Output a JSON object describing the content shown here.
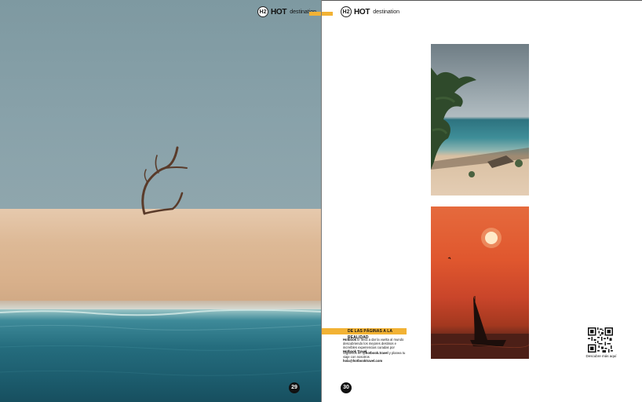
{
  "magazine": {
    "badge": "H2",
    "brand_hot": "HOT",
    "brand_destination": "destination",
    "accent_color": "#f2b234"
  },
  "left_page": {
    "page_number": "29"
  },
  "right_page": {
    "page_number": "30",
    "section_heading": "DE LAS PÁGINAS A LA REALIDAD",
    "paragraph_1": {
      "brand": "Hotbook",
      "text": " te lleva a dar la vuelta al mundo des­cubriendo los mejores destinos e increíbles experiencias curadas por ",
      "brand_2": "Hotbook Travel",
      "end": "."
    },
    "paragraph_2": {
      "lead": "Síguenos en ",
      "handle": "@hotbook.travel",
      "middle": " y planea tu viaje con nosotros ",
      "email": "hola@hotbooktravel.com"
    },
    "qr_caption": "Descubre más aquí"
  }
}
